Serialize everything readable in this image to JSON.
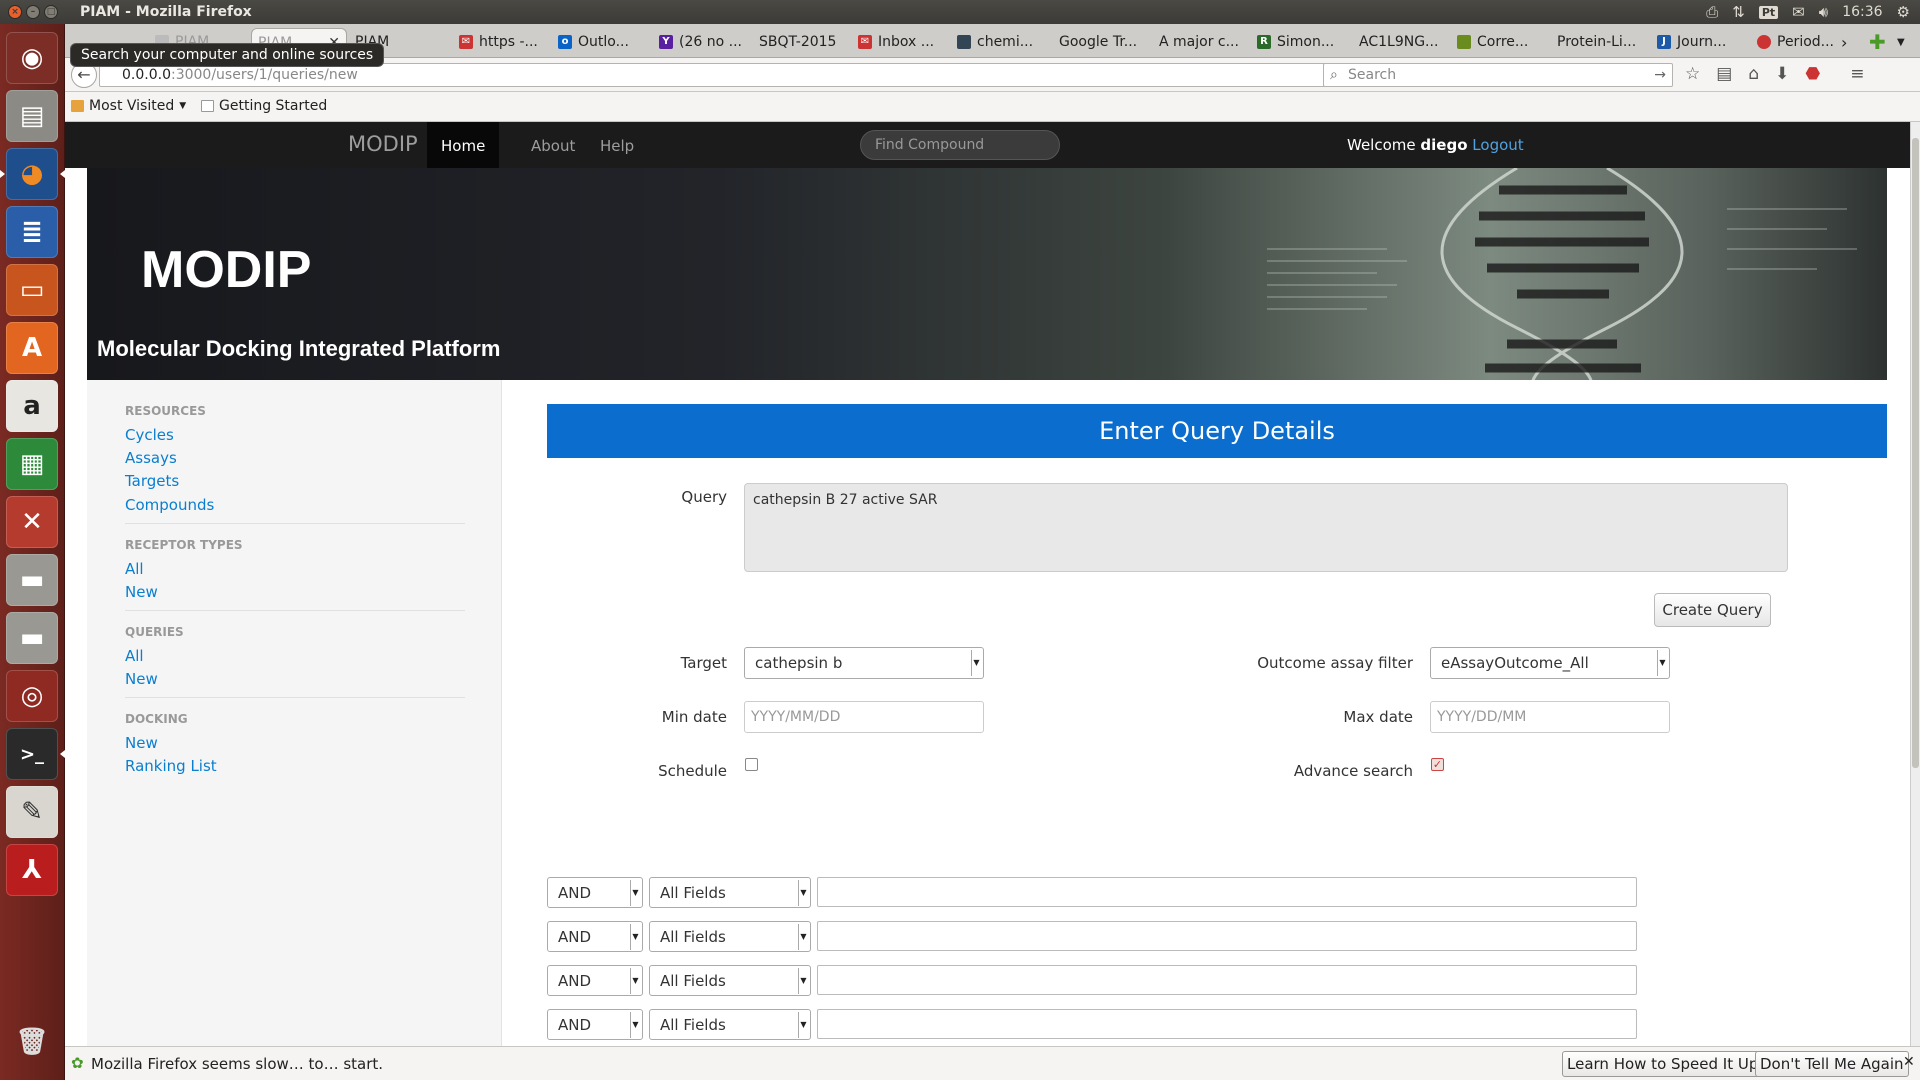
{
  "window": {
    "title": "PIAM - Mozilla Firefox"
  },
  "panel": {
    "clock": "16:36",
    "pt_label": "Pt"
  },
  "launcher": {
    "tooltip": "Search your computer and online sources"
  },
  "tabs": [
    {
      "label": "PIAM"
    },
    {
      "label": "PIAM"
    },
    {
      "label": "PIAM"
    },
    {
      "label": "https -..."
    },
    {
      "label": "Outlo..."
    },
    {
      "label": "(26 no ..."
    },
    {
      "label": "SBQT-2015"
    },
    {
      "label": "Inbox ..."
    },
    {
      "label": "chemi..."
    },
    {
      "label": "Google Tr..."
    },
    {
      "label": "A major c..."
    },
    {
      "label": "Simon..."
    },
    {
      "label": "AC1L9NG..."
    },
    {
      "label": "Corre..."
    },
    {
      "label": "Protein-Li..."
    },
    {
      "label": "Journ..."
    },
    {
      "label": "Period..."
    }
  ],
  "navbar": {
    "url_host": "0.0.0.0",
    "url_path": ":3000/users/1/queries/new",
    "search_placeholder": "Search"
  },
  "bookmarks": {
    "most_visited": "Most Visited",
    "getting_started": "Getting Started"
  },
  "site": {
    "brand": "MODIP",
    "nav": [
      "Home",
      "About",
      "Help"
    ],
    "find_placeholder": "Find Compound",
    "welcome": "Welcome",
    "user": "diego",
    "logout": "Logout"
  },
  "hero": {
    "title": "MODIP",
    "subtitle": "Molecular Docking Integrated Platform"
  },
  "sidebar": {
    "sections": [
      {
        "heading": "RESOURCES",
        "items": [
          "Cycles",
          "Assays",
          "Targets",
          "Compounds"
        ]
      },
      {
        "heading": "RECEPTOR TYPES",
        "items": [
          "All",
          "New"
        ]
      },
      {
        "heading": "QUERIES",
        "items": [
          "All",
          "New"
        ]
      },
      {
        "heading": "DOCKING",
        "items": [
          "New",
          "Ranking List"
        ]
      }
    ]
  },
  "form": {
    "heading": "Enter Query Details",
    "query_label": "Query",
    "query_value": "cathepsin B 27 active SAR",
    "create_button": "Create Query",
    "target_label": "Target",
    "target_value": "cathepsin b",
    "outcome_label": "Outcome assay filter",
    "outcome_value": "eAssayOutcome_All",
    "min_date_label": "Min date",
    "min_date_placeholder": "YYYY/MM/DD",
    "max_date_label": "Max date",
    "max_date_placeholder": "YYYY/DD/MM",
    "schedule_label": "Schedule",
    "schedule_checked": false,
    "advance_label": "Advance search",
    "advance_checked": true,
    "search_rows": [
      {
        "op": "AND",
        "field": "All Fields",
        "value": ""
      },
      {
        "op": "AND",
        "field": "All Fields",
        "value": ""
      },
      {
        "op": "AND",
        "field": "All Fields",
        "value": ""
      },
      {
        "op": "AND",
        "field": "All Fields",
        "value": ""
      }
    ]
  },
  "notification": {
    "text": "Mozilla Firefox seems slow… to… start.",
    "learn_button": "Learn How to Speed It Up",
    "dismiss_button": "Don't Tell Me Again"
  }
}
